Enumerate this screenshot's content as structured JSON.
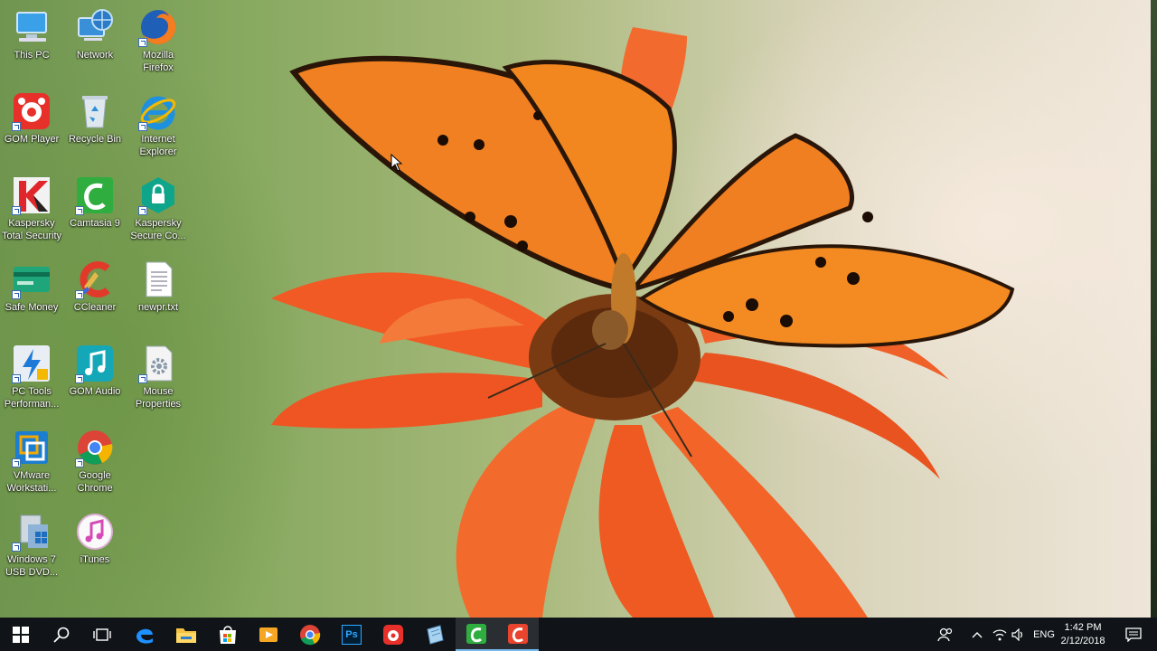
{
  "desktop": {
    "icons": [
      {
        "label": "This PC",
        "icon": "this-pc-icon"
      },
      {
        "label": "Network",
        "icon": "network-icon"
      },
      {
        "label": "Mozilla Firefox",
        "icon": "firefox-icon"
      },
      {
        "label": "GOM Player",
        "icon": "gom-player-icon"
      },
      {
        "label": "Recycle Bin",
        "icon": "recycle-bin-icon"
      },
      {
        "label": "Internet Explorer",
        "icon": "internet-explorer-icon"
      },
      {
        "label": "Kaspersky Total Security",
        "icon": "kaspersky-icon"
      },
      {
        "label": "Camtasia 9",
        "icon": "camtasia-icon"
      },
      {
        "label": "Kaspersky Secure Co...",
        "icon": "kaspersky-secure-connection-icon"
      },
      {
        "label": "Safe Money",
        "icon": "safe-money-icon"
      },
      {
        "label": "CCleaner",
        "icon": "ccleaner-icon"
      },
      {
        "label": "newpr.txt",
        "icon": "text-file-icon"
      },
      {
        "label": "PC Tools Performan...",
        "icon": "pc-tools-icon"
      },
      {
        "label": "GOM Audio",
        "icon": "gom-audio-icon"
      },
      {
        "label": "Mouse Properties",
        "icon": "mouse-properties-icon"
      },
      {
        "label": "VMware Workstati...",
        "icon": "vmware-icon"
      },
      {
        "label": "Google Chrome",
        "icon": "chrome-icon"
      },
      {
        "label": "Windows 7 USB DVD...",
        "icon": "windows-usb-dvd-icon"
      },
      {
        "label": "iTunes",
        "icon": "itunes-icon"
      }
    ]
  },
  "taskbar": {
    "pinned": [
      "start-icon",
      "search-icon",
      "task-view-icon",
      "edge-icon",
      "file-explorer-icon",
      "store-icon",
      "media-player-icon",
      "chrome-icon",
      "photoshop-icon",
      "gom-player-icon",
      "notepad-icon",
      "camtasia-icon",
      "camtasia-recorder-icon"
    ],
    "photoshop_label": "Ps",
    "tray": {
      "language": "ENG",
      "time": "1:42 PM",
      "date": "2/12/2018"
    }
  },
  "colors": {
    "taskbar": "#101418",
    "accent_orange": "#f07a1e",
    "camtasia_green": "#2fae3f"
  }
}
